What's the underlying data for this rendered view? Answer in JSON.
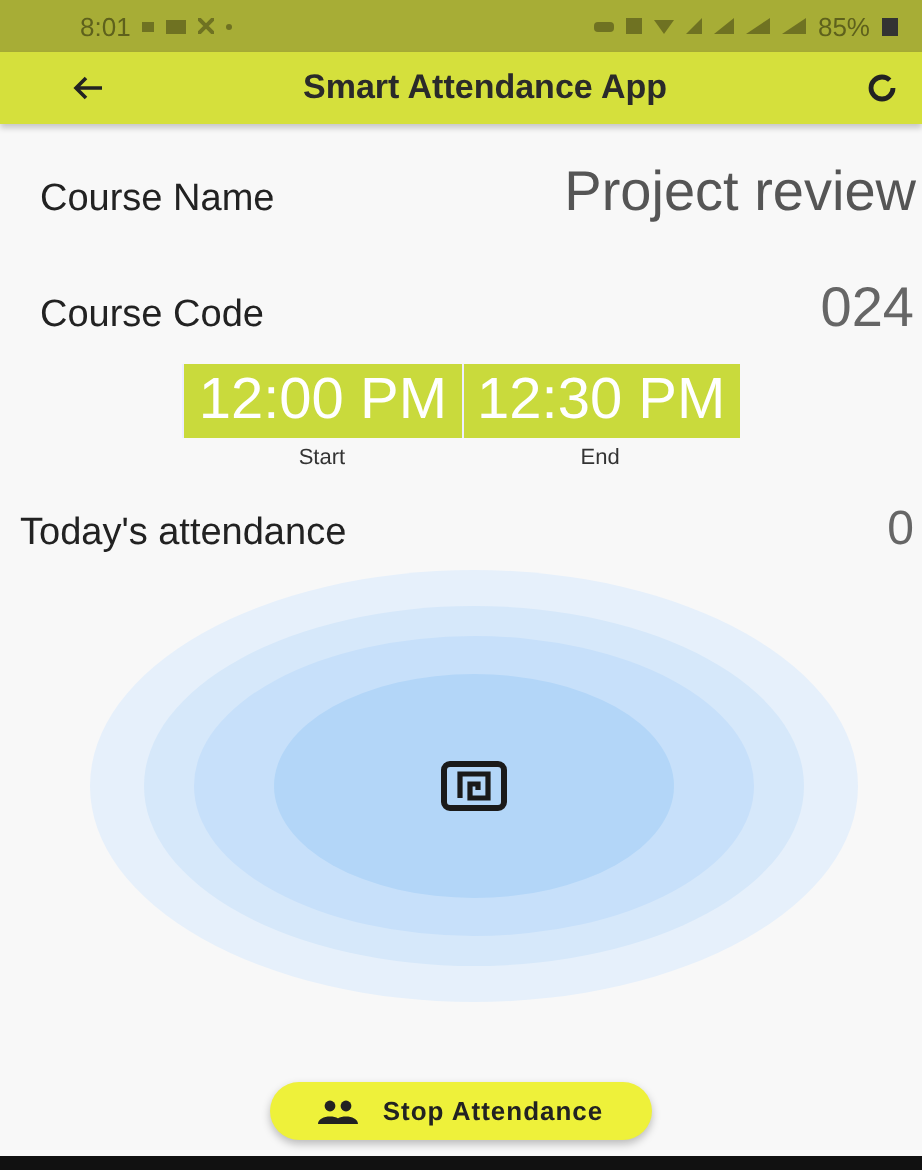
{
  "status_bar": {
    "time": "8:01",
    "battery": "85%"
  },
  "app_bar": {
    "title": "Smart Attendance App"
  },
  "course": {
    "name_label": "Course Name",
    "name": "Project review",
    "code_label": "Course Code",
    "code": "024"
  },
  "times": [
    {
      "value": "12:00 PM",
      "label": "Start"
    },
    {
      "value": "12:30 PM",
      "label": "End"
    }
  ],
  "attendance": {
    "label": "Today's attendance",
    "count": "0"
  },
  "stop_button": {
    "label": "Stop Attendance"
  }
}
